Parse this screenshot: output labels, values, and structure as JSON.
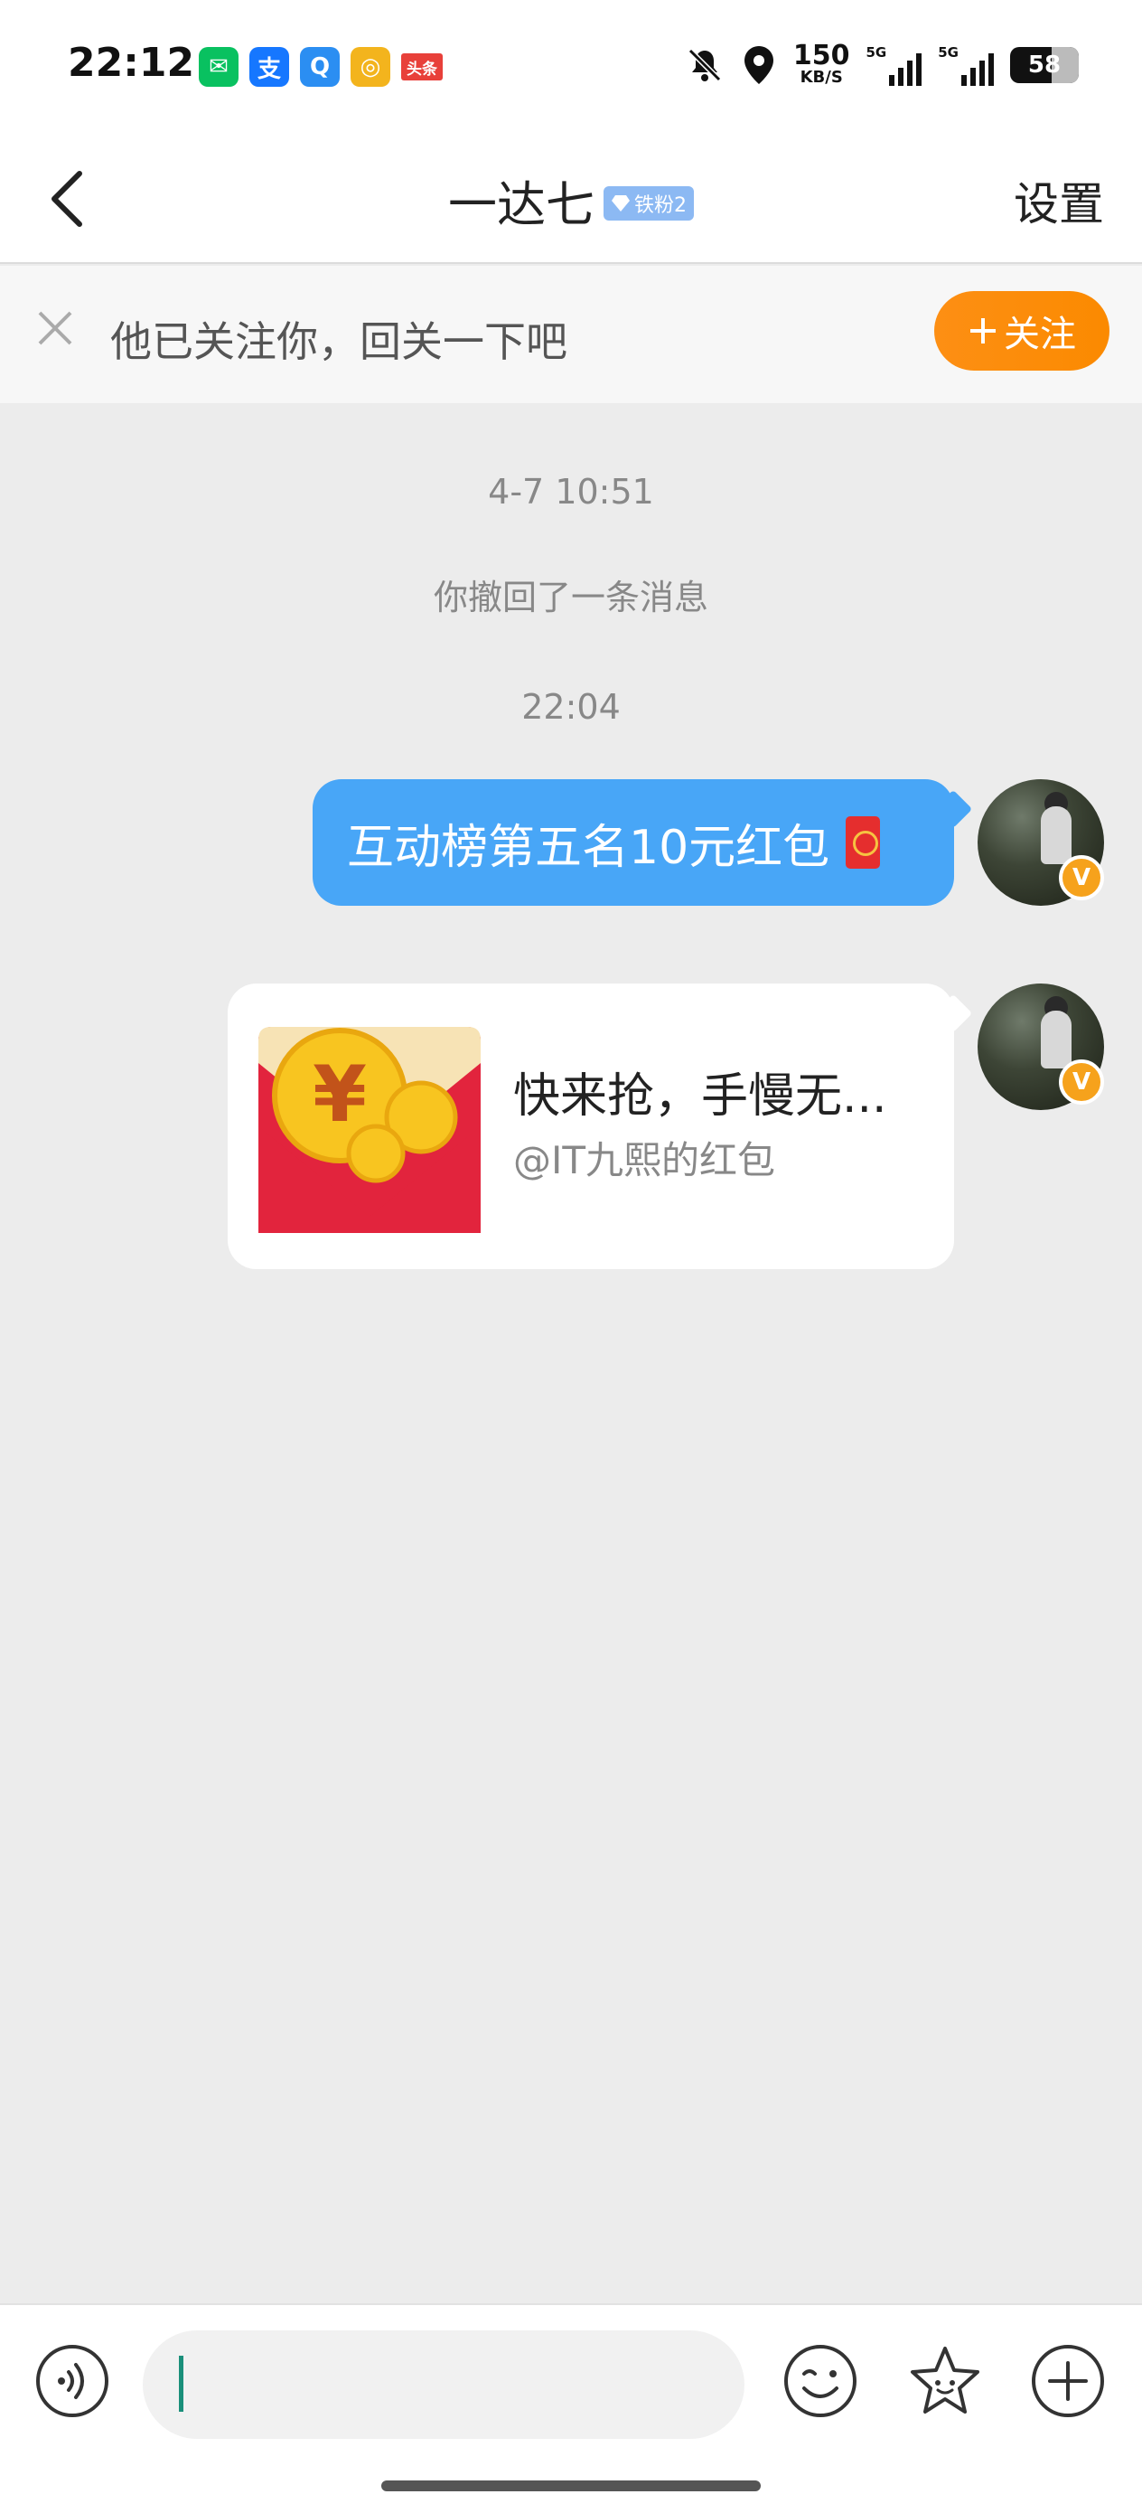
{
  "status_bar": {
    "time": "22:12",
    "apps": [
      {
        "name": "wechat-icon",
        "glyph": "◉",
        "color": "#09c160"
      },
      {
        "name": "alipay-icon",
        "glyph": "支",
        "color": "#1677ff"
      },
      {
        "name": "qq-browser-icon",
        "glyph": "Q",
        "color": "#2b8ef2"
      },
      {
        "name": "weibo-icon",
        "glyph": "◎",
        "color": "#f3b41d"
      },
      {
        "name": "toutiao-icon",
        "glyph": "头条",
        "color": "#e8403a"
      }
    ],
    "net_speed_value": "150",
    "net_speed_unit": "KB/S",
    "sim1_label": "5G",
    "sim2_label": "5G",
    "battery": "58"
  },
  "navbar": {
    "title": "一达七",
    "fan_badge": "铁粉2",
    "settings_label": "设置"
  },
  "follow_banner": {
    "text": "他已关注你，回关一下吧",
    "follow_button_label": "关注"
  },
  "chat": {
    "timestamp_1": "4-7 10:51",
    "recall_notice": "你撤回了一条消息",
    "timestamp_2": "22:04",
    "message_1": "互动榜第五名10元红包",
    "red_packet": {
      "title": "快来抢，手慢无...",
      "subtitle": "@IT九熙的红包"
    }
  },
  "input_bar": {
    "input_value": ""
  },
  "colors": {
    "accent_blue": "#48a6f7",
    "follow_orange": "#fd8f14",
    "background": "#ececec"
  }
}
